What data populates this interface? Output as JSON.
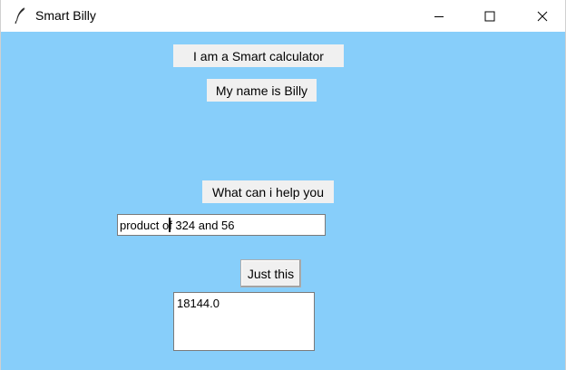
{
  "window": {
    "title": "Smart Billy",
    "icon": "feather-icon",
    "controls": [
      "minimize-icon",
      "maximize-icon",
      "close-icon"
    ]
  },
  "content": {
    "background": "#87cefa",
    "intro_label": "I am a Smart calculator",
    "name_label": "My name is Billy",
    "prompt_label": "What can i help you",
    "query_input": {
      "value": "product of 324 and 56"
    },
    "submit_button": "Just this",
    "result_text": "18144.0"
  }
}
